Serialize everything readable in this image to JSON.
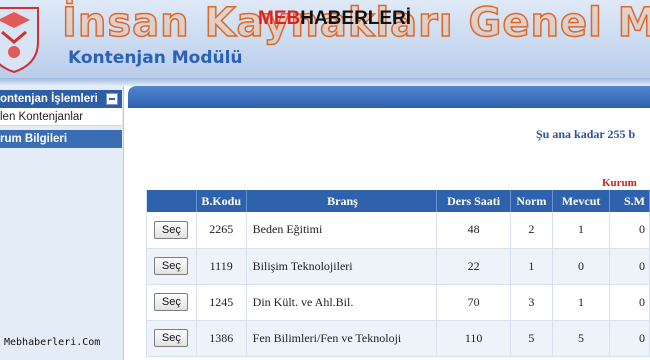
{
  "header": {
    "title": "İnsan Kaynakları Genel Müdürlüğü",
    "subtitle": "Kontenjan Modülü",
    "watermark_part1": "MEB",
    "watermark_part2": "HABERLERİ"
  },
  "sidebar": {
    "section1_label": "ontenjan İşlemleri",
    "item1_label": "len Kontenjanlar",
    "section2_label": "rum Bilgileri",
    "footer": "Mebhaberleri.Com"
  },
  "main": {
    "info_text": "Şu ana kadar 255 b",
    "kurum_label": "Kurum"
  },
  "table": {
    "headers": [
      "",
      "B.Kodu",
      "Branş",
      "Ders Saati",
      "Norm",
      "Mevcut",
      "S.M"
    ],
    "rows": [
      {
        "button": "Seç",
        "kod": "2265",
        "brans": "Beden Eğitimi",
        "ders_saati": "48",
        "norm": "2",
        "mevcut": "1",
        "sm": "0"
      },
      {
        "button": "Seç",
        "kod": "1119",
        "brans": "Bilişim Teknolojileri",
        "ders_saati": "22",
        "norm": "1",
        "mevcut": "0",
        "sm": "0"
      },
      {
        "button": "Seç",
        "kod": "1245",
        "brans": "Din Kült. ve Ahl.Bil.",
        "ders_saati": "70",
        "norm": "3",
        "mevcut": "1",
        "sm": "0"
      },
      {
        "button": "Seç",
        "kod": "1386",
        "brans": "Fen Bilimleri/Fen ve Teknoloji",
        "ders_saati": "110",
        "norm": "5",
        "mevcut": "5",
        "sm": "0"
      }
    ]
  },
  "colors": {
    "header_bg": "#c8d9f0",
    "title_orange": "#d96a2a",
    "subtitle_blue": "#2d61b5",
    "table_header": "#2f62ad",
    "info_blue": "#2952a3",
    "kurum_red": "#d12020"
  }
}
